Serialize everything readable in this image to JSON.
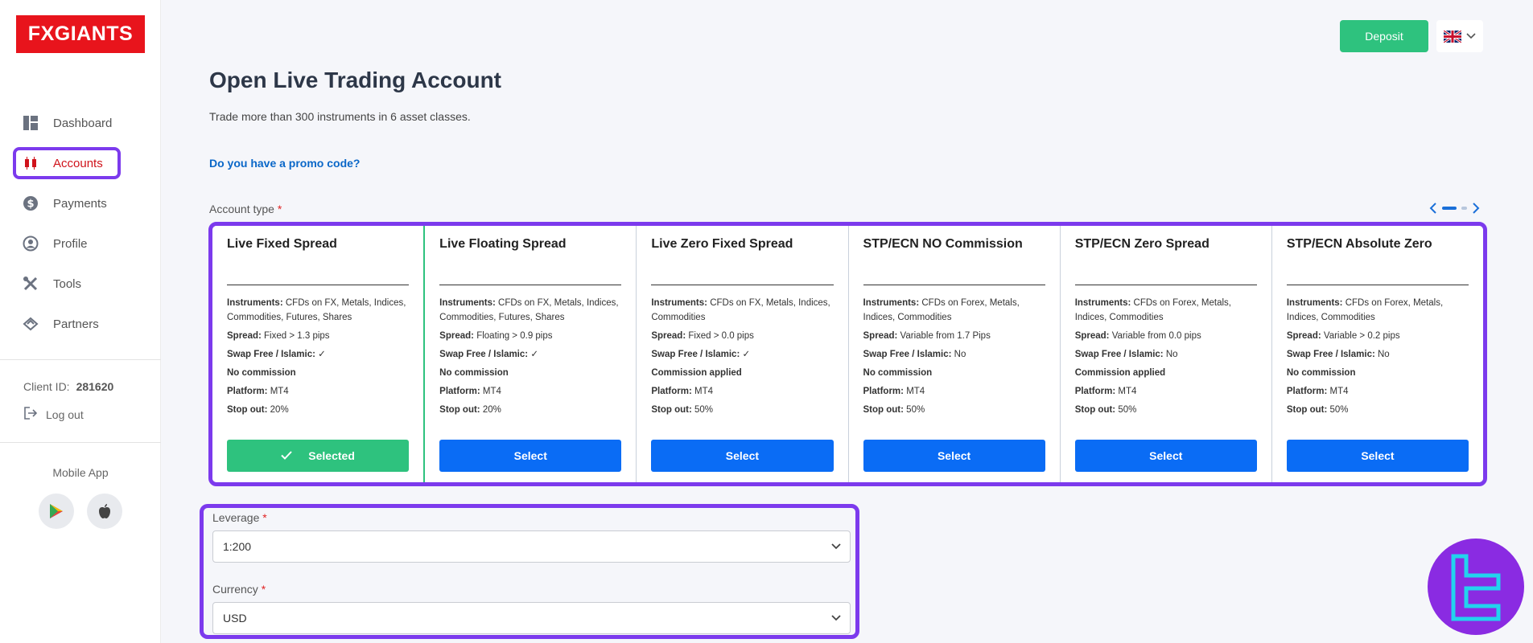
{
  "brand": {
    "logo_text": "FXGIANTS",
    "accent": "#e8141c",
    "highlight": "#7c3aed"
  },
  "sidebar": {
    "items": [
      {
        "label": "Dashboard",
        "icon": "dashboard-icon"
      },
      {
        "label": "Accounts",
        "icon": "candles-icon",
        "active": true
      },
      {
        "label": "Payments",
        "icon": "dollar-icon"
      },
      {
        "label": "Profile",
        "icon": "user-icon"
      },
      {
        "label": "Tools",
        "icon": "tools-icon"
      },
      {
        "label": "Partners",
        "icon": "handshake-icon"
      }
    ],
    "client_label": "Client ID:",
    "client_id": "281620",
    "logout_label": "Log out",
    "mobile_app_label": "Mobile App"
  },
  "header": {
    "deposit_label": "Deposit",
    "language": "flag-uk-icon"
  },
  "main": {
    "title": "Open Live Trading Account",
    "subtitle": "Trade more than 300 instruments in 6 asset classes.",
    "promo_link": "Do you have a promo code?",
    "account_type_label": "Account type",
    "required_mark": "*",
    "cards": [
      {
        "title": "Live Fixed Spread",
        "instruments": "CFDs on FX, Metals, Indices, Commodities, Futures, Shares",
        "spread": "Fixed > 1.3 pips",
        "swap": "✓",
        "commission": "No commission",
        "platform": "MT4",
        "stop_out": "20%",
        "button": "Selected",
        "selected": true
      },
      {
        "title": "Live Floating Spread",
        "instruments": "CFDs on FX, Metals, Indices, Commodities, Futures, Shares",
        "spread": "Floating > 0.9 pips",
        "swap": "✓",
        "commission": "No commission",
        "platform": "MT4",
        "stop_out": "20%",
        "button": "Select"
      },
      {
        "title": "Live Zero Fixed Spread",
        "instruments": "CFDs on FX, Metals, Indices, Commodities",
        "spread": "Fixed > 0.0 pips",
        "swap": "✓",
        "commission": "Commission applied",
        "platform": "MT4",
        "stop_out": "50%",
        "button": "Select"
      },
      {
        "title": "STP/ECN NO Commission",
        "instruments": "CFDs on Forex, Metals, Indices, Commodities",
        "spread": "Variable from 1.7 Pips",
        "swap": "No",
        "commission": "No commission",
        "platform": "MT4",
        "stop_out": "50%",
        "button": "Select"
      },
      {
        "title": "STP/ECN Zero Spread",
        "instruments": "CFDs on Forex, Metals, Indices, Commodities",
        "spread": "Variable from 0.0 pips",
        "swap": "No",
        "commission": "Commission applied",
        "platform": "MT4",
        "stop_out": "50%",
        "button": "Select"
      },
      {
        "title": "STP/ECN Absolute Zero",
        "instruments": "CFDs on Forex, Metals, Indices, Commodities",
        "spread": "Variable > 0.2 pips",
        "swap": "No",
        "commission": "No commission",
        "platform": "MT4",
        "stop_out": "50%",
        "button": "Select"
      }
    ],
    "labels": {
      "instruments": "Instruments:",
      "spread": "Spread:",
      "swap": "Swap Free / Islamic:",
      "platform": "Platform:",
      "stop_out": "Stop out:"
    },
    "leverage": {
      "label": "Leverage",
      "value": "1:200"
    },
    "currency": {
      "label": "Currency",
      "value": "USD"
    }
  }
}
